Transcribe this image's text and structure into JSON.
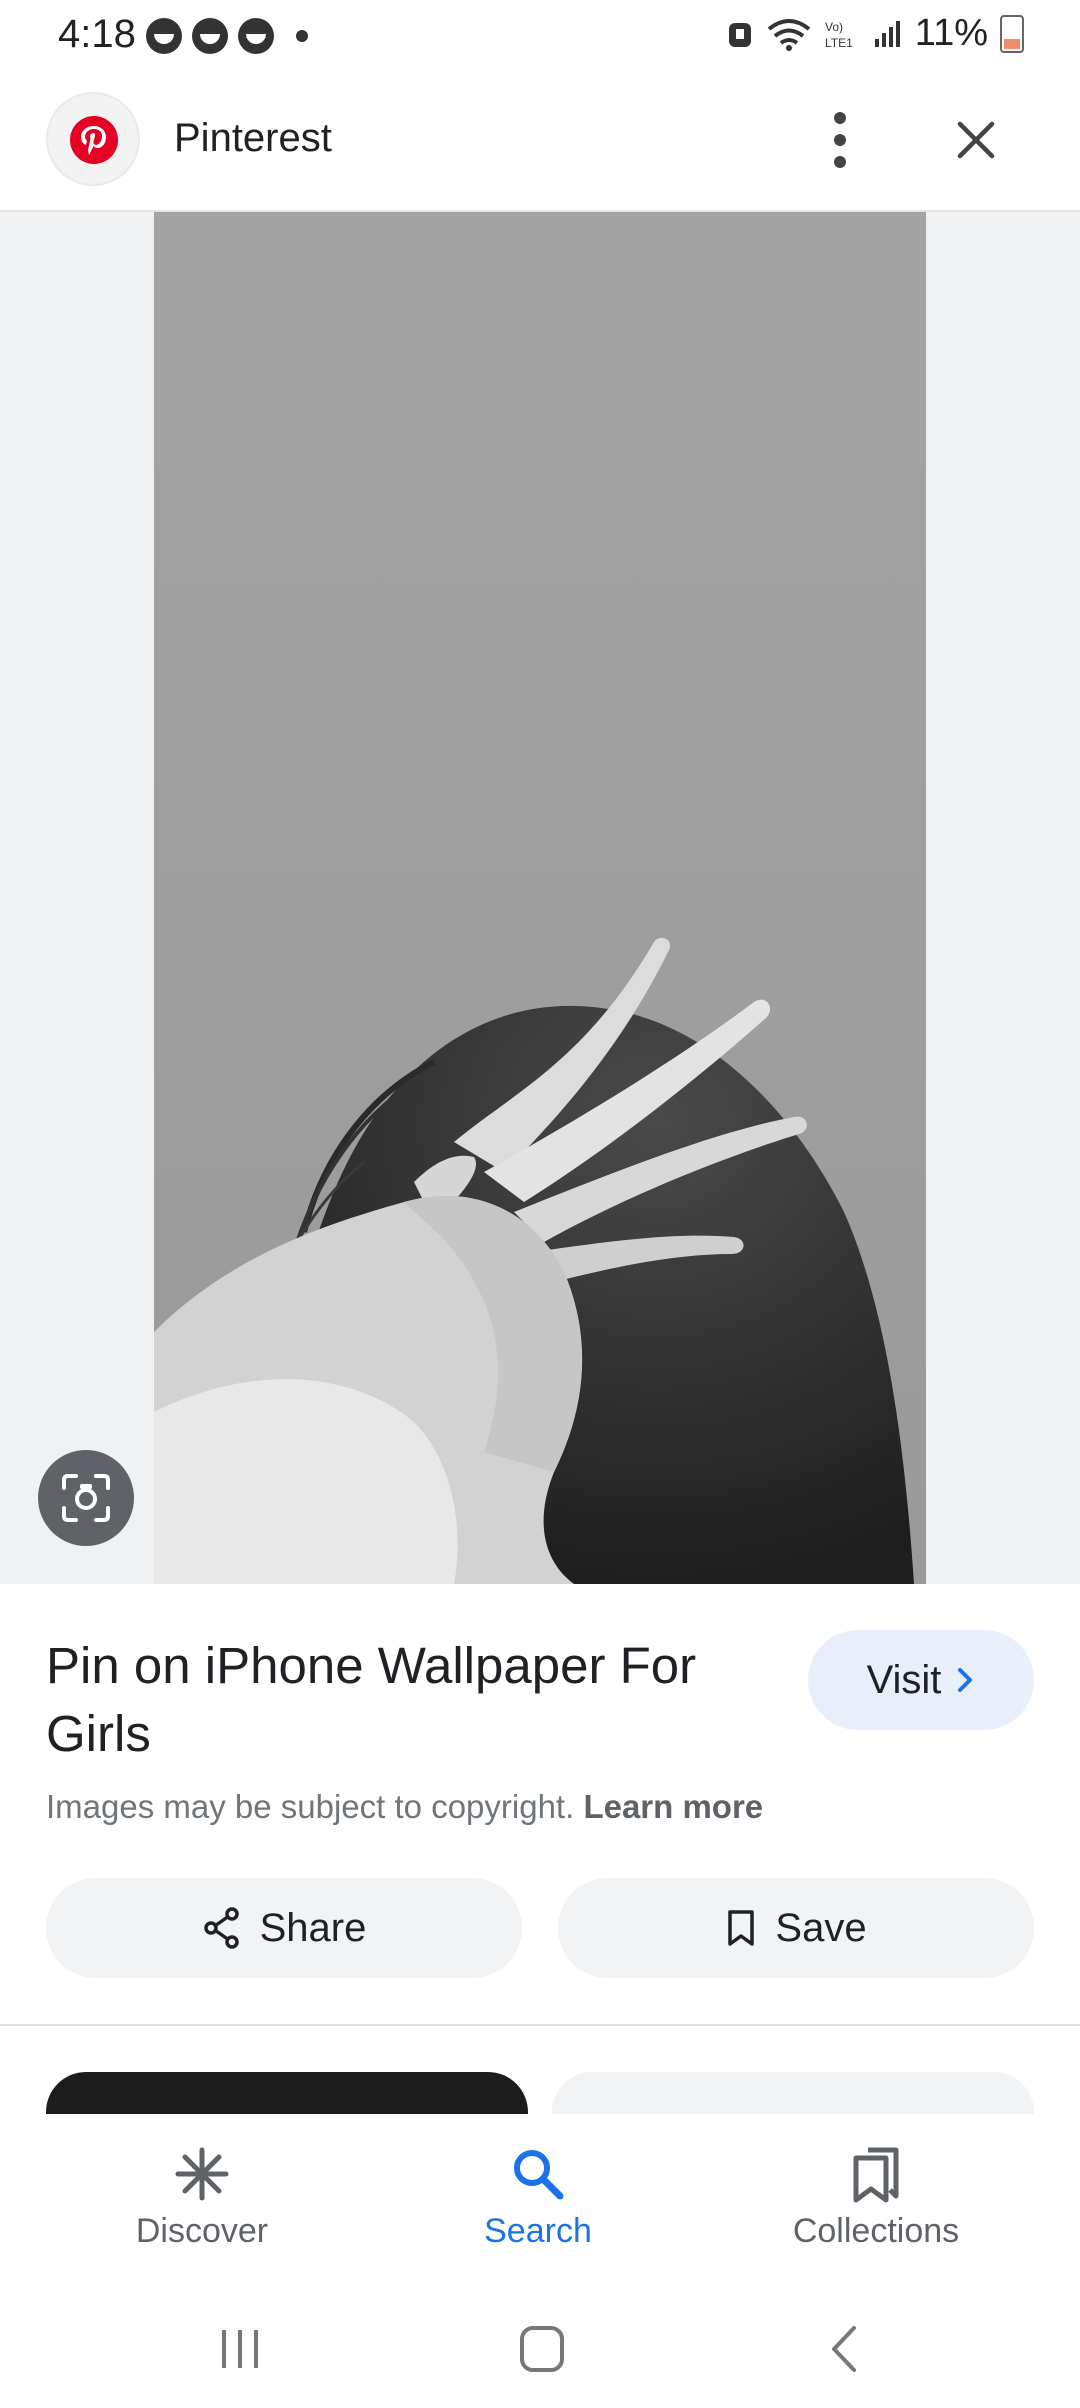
{
  "status": {
    "time": "4:18",
    "battery": "11%"
  },
  "header": {
    "site_name": "Pinterest",
    "menu_icon": "more-vert-icon",
    "close_icon": "close-icon"
  },
  "result": {
    "title": "Pin on iPhone Wallpaper For Girls",
    "visit_label": "Visit",
    "copyright_text": "Images may be subject to copyright.",
    "learn_more": "Learn more"
  },
  "actions": {
    "share_label": "Share",
    "save_label": "Save"
  },
  "bottom_nav": {
    "items": [
      {
        "label": "Discover",
        "icon": "asterisk-icon"
      },
      {
        "label": "Search",
        "icon": "search-icon",
        "active": true
      },
      {
        "label": "Collections",
        "icon": "collections-icon"
      }
    ]
  },
  "colors": {
    "accent": "#1a73e8",
    "brand": "#e60023",
    "visit_bg": "#e8effb"
  }
}
